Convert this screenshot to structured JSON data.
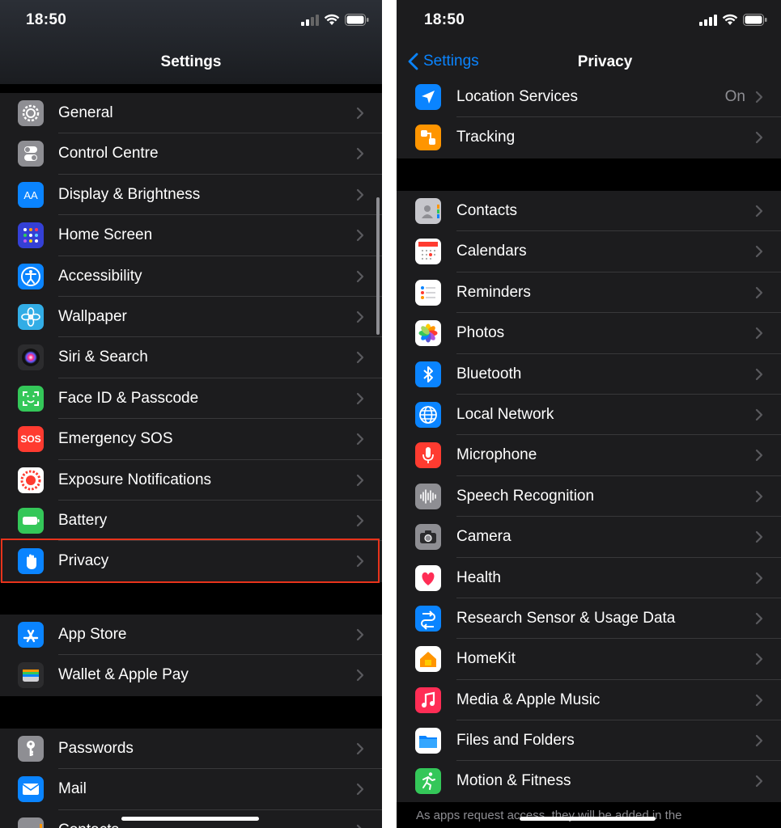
{
  "left": {
    "status_time": "18:50",
    "nav_title": "Settings",
    "groups": [
      [
        {
          "label": "General",
          "icon": "gear-icon",
          "color": "#8e8e93"
        },
        {
          "label": "Control Centre",
          "icon": "toggles-icon",
          "color": "#8e8e93"
        },
        {
          "label": "Display & Brightness",
          "icon": "text-size-icon",
          "color": "#0a84ff"
        },
        {
          "label": "Home Screen",
          "icon": "app-grid-icon",
          "color": "#3440d6"
        },
        {
          "label": "Accessibility",
          "icon": "accessibility-icon",
          "color": "#0a84ff"
        },
        {
          "label": "Wallpaper",
          "icon": "flower-icon",
          "color": "#32ade6"
        },
        {
          "label": "Siri & Search",
          "icon": "siri-icon",
          "color": "#2c2c2e"
        },
        {
          "label": "Face ID & Passcode",
          "icon": "face-id-icon",
          "color": "#34c759"
        },
        {
          "label": "Emergency SOS",
          "icon": "sos-icon",
          "color": "#ff3b30",
          "glyph": "SOS"
        },
        {
          "label": "Exposure Notifications",
          "icon": "exposure-icon",
          "color": "#ffffff"
        },
        {
          "label": "Battery",
          "icon": "battery-icon",
          "color": "#34c759"
        },
        {
          "label": "Privacy",
          "icon": "hand-icon",
          "color": "#0a84ff"
        }
      ],
      [
        {
          "label": "App Store",
          "icon": "app-store-icon",
          "color": "#0a84ff"
        },
        {
          "label": "Wallet & Apple Pay",
          "icon": "wallet-icon",
          "color": "#2c2c2e"
        }
      ],
      [
        {
          "label": "Passwords",
          "icon": "key-icon",
          "color": "#8e8e93"
        },
        {
          "label": "Mail",
          "icon": "mail-icon",
          "color": "#0a84ff"
        },
        {
          "label": "Contacts",
          "icon": "contacts-icon",
          "color": "#8e8e93"
        }
      ]
    ]
  },
  "right": {
    "status_time": "18:50",
    "back_label": "Settings",
    "nav_title": "Privacy",
    "groups": [
      [
        {
          "label": "Location Services",
          "icon": "location-arrow-icon",
          "color": "#0a84ff",
          "value": "On"
        },
        {
          "label": "Tracking",
          "icon": "tracking-icon",
          "color": "#ff9500"
        }
      ],
      [
        {
          "label": "Contacts",
          "icon": "contacts-icon",
          "color": "#c7c7cc"
        },
        {
          "label": "Calendars",
          "icon": "calendar-icon",
          "color": "#ffffff"
        },
        {
          "label": "Reminders",
          "icon": "reminders-icon",
          "color": "#ffffff"
        },
        {
          "label": "Photos",
          "icon": "photos-icon",
          "color": "#ffffff"
        },
        {
          "label": "Bluetooth",
          "icon": "bluetooth-icon",
          "color": "#0a84ff"
        },
        {
          "label": "Local Network",
          "icon": "globe-icon",
          "color": "#0a84ff"
        },
        {
          "label": "Microphone",
          "icon": "microphone-icon",
          "color": "#ff3b30"
        },
        {
          "label": "Speech Recognition",
          "icon": "waveform-icon",
          "color": "#8e8e93"
        },
        {
          "label": "Camera",
          "icon": "camera-icon",
          "color": "#8e8e93"
        },
        {
          "label": "Health",
          "icon": "heart-icon",
          "color": "#ffffff"
        },
        {
          "label": "Research Sensor & Usage Data",
          "icon": "research-icon",
          "color": "#0a84ff"
        },
        {
          "label": "HomeKit",
          "icon": "home-icon",
          "color": "#ffffff"
        },
        {
          "label": "Media & Apple Music",
          "icon": "music-note-icon",
          "color": "#ff2d55"
        },
        {
          "label": "Files and Folders",
          "icon": "folder-icon",
          "color": "#ffffff"
        },
        {
          "label": "Motion & Fitness",
          "icon": "running-icon",
          "color": "#34c759"
        }
      ]
    ],
    "footnote": "As apps request access, they will be added in the"
  }
}
